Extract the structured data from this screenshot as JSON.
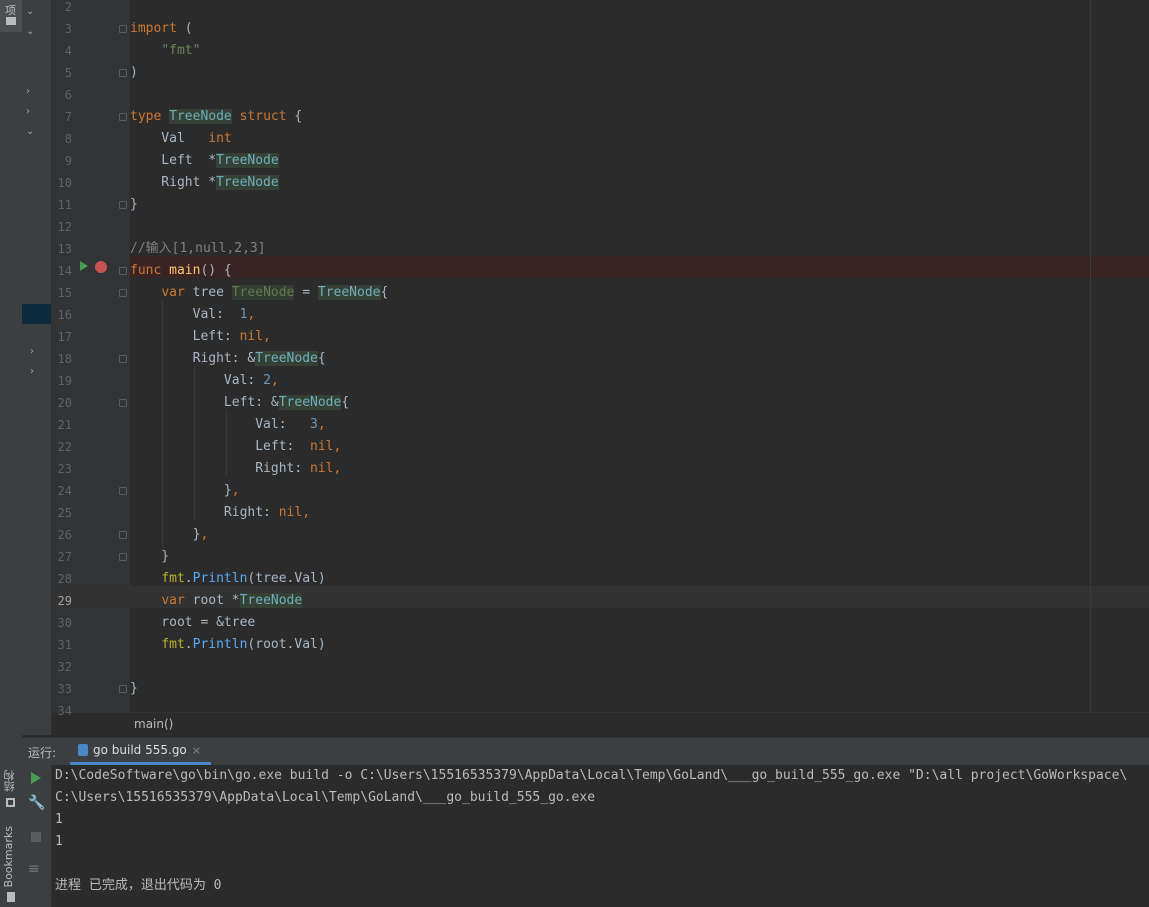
{
  "left_stripe": {
    "top_label": "项",
    "structure_label": "结构",
    "bookmarks_label": "Bookmarks"
  },
  "editor": {
    "lines": [
      {
        "no": "2",
        "html": ""
      },
      {
        "no": "3",
        "html": "<span class='kw'>import</span> ("
      },
      {
        "no": "4",
        "html": "    <span class='str'>\"fmt\"</span>"
      },
      {
        "no": "5",
        "html": ")"
      },
      {
        "no": "6",
        "html": ""
      },
      {
        "no": "7",
        "html": "<span class='kw'>type</span> <span class='typ'>TreeNode</span> <span class='kw'>struct</span> {"
      },
      {
        "no": "8",
        "html": "    Val   <span class='kw'>int</span>"
      },
      {
        "no": "9",
        "html": "    Left  *<span class='typ'>TreeNode</span>"
      },
      {
        "no": "10",
        "html": "    Right *<span class='typ'>TreeNode</span>"
      },
      {
        "no": "11",
        "html": "}"
      },
      {
        "no": "12",
        "html": ""
      },
      {
        "no": "13",
        "html": "<span class='cmt'>//输入[1,null,2,3]</span>"
      },
      {
        "no": "14",
        "html": "<span class='kw'>func</span> <span class='fn'>main</span>() {"
      },
      {
        "no": "15",
        "html": "    <span class='kw'>var</span> tree <span class='typ-unused'>TreeNode</span> = <span class='typ'>TreeNode</span>{"
      },
      {
        "no": "16",
        "html": "        Val:  <span class='num'>1</span><span class='kw'>,</span>"
      },
      {
        "no": "17",
        "html": "        Left: <span class='kw'>nil,</span>"
      },
      {
        "no": "18",
        "html": "        Right: &amp;<span class='typ'>TreeNode</span>{"
      },
      {
        "no": "19",
        "html": "            Val: <span class='num'>2</span><span class='kw'>,</span>"
      },
      {
        "no": "20",
        "html": "            Left: &amp;<span class='typ'>TreeNode</span>{"
      },
      {
        "no": "21",
        "html": "                Val:   <span class='num'>3</span><span class='kw'>,</span>"
      },
      {
        "no": "22",
        "html": "                Left:  <span class='kw'>nil,</span>"
      },
      {
        "no": "23",
        "html": "                Right: <span class='kw'>nil,</span>"
      },
      {
        "no": "24",
        "html": "            }<span class='kw'>,</span>"
      },
      {
        "no": "25",
        "html": "            Right: <span class='kw'>nil,</span>"
      },
      {
        "no": "26",
        "html": "        }<span class='kw'>,</span>"
      },
      {
        "no": "27",
        "html": "    }"
      },
      {
        "no": "28",
        "html": "    <span class='pkg'>fmt</span>.<span class='call'>Println</span>(tree.Val)"
      },
      {
        "no": "29",
        "html": "    <span class='kw'>var</span> root *<span class='typ'>TreeNode</span>"
      },
      {
        "no": "30",
        "html": "    root = &amp;tree"
      },
      {
        "no": "31",
        "html": "    <span class='pkg'>fmt</span>.<span class='call'>Println</span>(root.Val)"
      },
      {
        "no": "32",
        "html": ""
      },
      {
        "no": "33",
        "html": "}"
      },
      {
        "no": "34",
        "html": ""
      }
    ],
    "current_line": "29",
    "breakpoint_line": "14"
  },
  "breadcrumb": {
    "text": "main()"
  },
  "run_window": {
    "title": "运行:",
    "tab_label": "go build 555.go",
    "tab_close": "×"
  },
  "console": {
    "lines": [
      "D:\\CodeSoftware\\go\\bin\\go.exe build -o C:\\Users\\15516535379\\AppData\\Local\\Temp\\GoLand\\___go_build_555_go.exe \"D:\\all project\\GoWorkspace\\",
      "C:\\Users\\15516535379\\AppData\\Local\\Temp\\GoLand\\___go_build_555_go.exe",
      "1",
      "1",
      "",
      "进程 已完成，退出代码为 0"
    ]
  },
  "colors": {
    "background": "#2b2b2b",
    "keyword": "#cc7832",
    "string": "#6a8759",
    "number": "#6897bb",
    "breakpoint": "#c75450",
    "run": "#499c54"
  }
}
